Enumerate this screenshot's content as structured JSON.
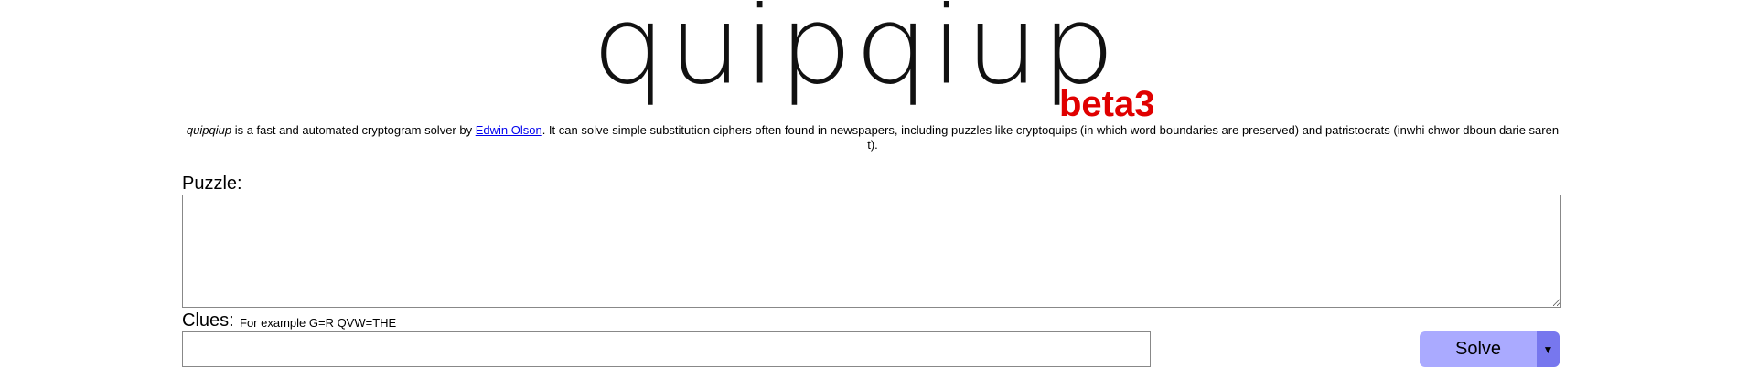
{
  "header": {
    "logo_text": "quipqiup",
    "version_badge": "beta3"
  },
  "description": {
    "app_name": "quipqiup",
    "text_before_link": " is a fast and automated cryptogram solver by ",
    "author_link": "Edwin Olson",
    "text_after_link": ". It can solve simple substitution ciphers often found in newspapers, including puzzles like cryptoquips (in which word boundaries are preserved) and patristocrats (inwhi chwor dboun darie saren t)."
  },
  "puzzle": {
    "label": "Puzzle:",
    "value": ""
  },
  "clues": {
    "label": "Clues:",
    "example": "For example G=R QVW=THE",
    "value": ""
  },
  "solve": {
    "label": "Solve",
    "caret": "▼"
  },
  "colors": {
    "beta": "#e00000",
    "solve_button": "#aaaaff",
    "solve_caret": "#7777ee",
    "link": "#0000ee"
  }
}
